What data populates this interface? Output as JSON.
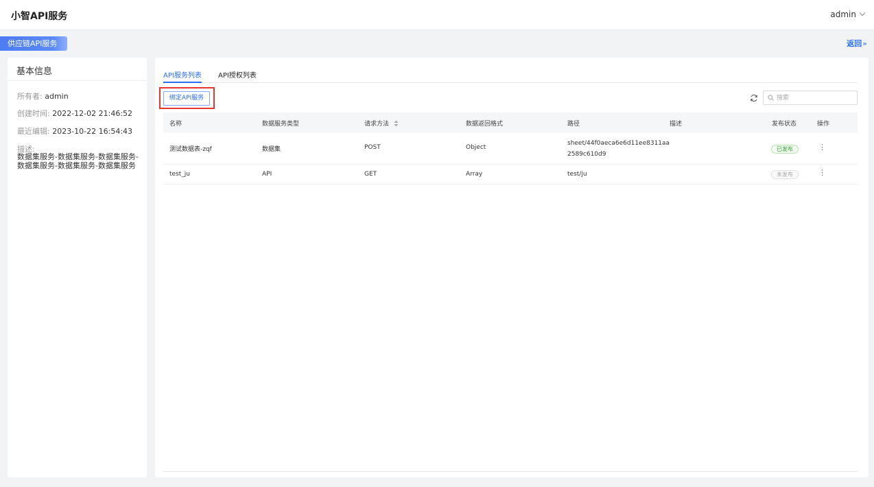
{
  "app": {
    "title": "小智API服务",
    "user": "admin"
  },
  "breadcrumb": {
    "tag": "供应链API服务",
    "back_label": "返回",
    "back_arrow": "»"
  },
  "info": {
    "title": "基本信息",
    "owner_label": "所有者:",
    "owner": "admin",
    "created_label": "创建时间:",
    "created": "2022-12-02 21:46:52",
    "edited_label": "最近编辑:",
    "edited": "2023-10-22 16:54:43",
    "desc_label": "描述:",
    "desc": "数据集服务-数据集服务-数据集服务-数据集服务-数据集服务-数据集服务"
  },
  "tabs": [
    "API服务列表",
    "API授权列表"
  ],
  "toolbar": {
    "bind_label": "绑定API服务",
    "search_placeholder": "搜索"
  },
  "table": {
    "headers": [
      "名称",
      "数据服务类型",
      "请求方法",
      "数据返回格式",
      "路径",
      "描述",
      "发布状态",
      "操作"
    ],
    "rows": [
      {
        "name": "测试数据表-zqf",
        "type": "数据集",
        "method": "POST",
        "format": "Object",
        "path_line1": "sheet/44f0aeca6e6d11ee8311aa",
        "path_line2": "2589c610d9",
        "desc": "",
        "status": "已发布",
        "more": "⋮"
      },
      {
        "name": "test_ju",
        "type": "API",
        "method": "GET",
        "format": "Array",
        "path_line1": "test/ju",
        "path_line2": "",
        "desc": "",
        "status": "未发布",
        "more": "⋮"
      }
    ]
  },
  "colors": {
    "accent": "#2b6ef6",
    "highlight": "#e8352e",
    "published": "#37a536"
  }
}
